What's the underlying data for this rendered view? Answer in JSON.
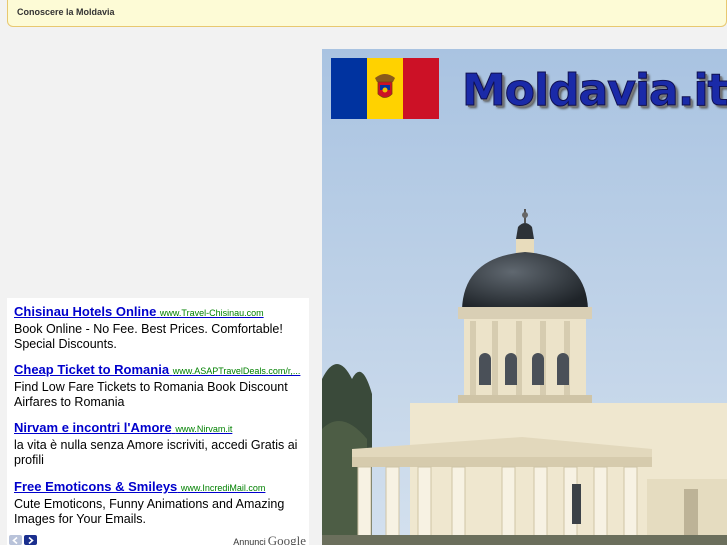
{
  "header": {
    "title": "Conoscere la Moldavia"
  },
  "hero": {
    "logo_text": "Moldavia.it",
    "flag_colors": [
      "#0033a0",
      "#ffd200",
      "#cc1126"
    ]
  },
  "ads": {
    "items": [
      {
        "title": "Chisinau Hotels Online",
        "url": "www.Travel-Chisinau.com",
        "desc": "Book Online - No Fee. Best Prices. Comfortable! Special Discounts."
      },
      {
        "title": "Cheap Ticket to Romania",
        "url": "www.ASAPTravelDeals.com/r,...",
        "desc": "Find Low Fare Tickets to Romania Book Discount Airfares to Romania"
      },
      {
        "title": "Nirvam e incontri l'Amore",
        "url": "www.Nirvam.it",
        "desc": "la vita è nulla senza Amore iscriviti, accedi Gratis ai profili"
      },
      {
        "title": "Free Emoticons & Smileys",
        "url": "www.IncrediMail.com",
        "desc": "Cute Emoticons, Funny Animations and Amazing Images for Your Emails."
      }
    ],
    "footer_label": "Annunci",
    "footer_brand": "Google"
  }
}
